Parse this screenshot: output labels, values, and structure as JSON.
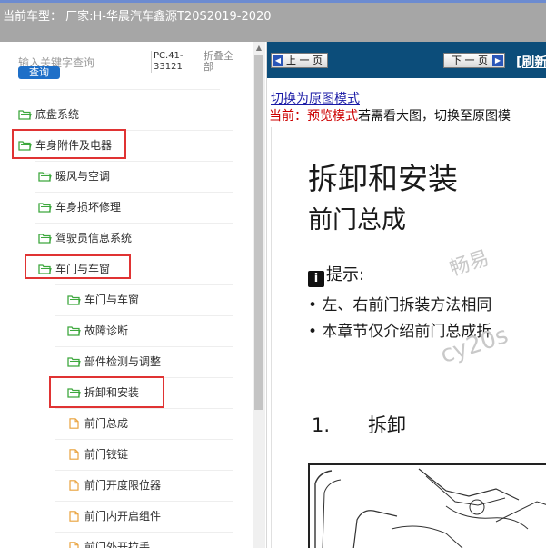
{
  "window": {
    "title": "当前车型： 厂家:H-华晨汽车鑫源T20S2019-2020"
  },
  "left_panel": {
    "search_placeholder": "输入关键字查询",
    "search_button": "查询",
    "pc_code": "PC.41-33121",
    "collapse_all": "折叠全部",
    "tree": [
      {
        "label": "底盘系统",
        "icon": "folder-open-icon"
      },
      {
        "label": "车身附件及电器",
        "icon": "folder-open-icon"
      },
      {
        "label": "暖风与空调",
        "icon": "folder-open-icon"
      },
      {
        "label": "车身损坏修理",
        "icon": "folder-open-icon"
      },
      {
        "label": "驾驶员信息系统",
        "icon": "folder-open-icon"
      },
      {
        "label": "车门与车窗",
        "icon": "folder-open-icon"
      },
      {
        "label": "车门与车窗",
        "icon": "folder-open-icon"
      },
      {
        "label": "故障诊断",
        "icon": "folder-open-icon"
      },
      {
        "label": "部件检测与调整",
        "icon": "folder-open-icon"
      },
      {
        "label": "拆卸和安装",
        "icon": "folder-open-icon"
      },
      {
        "label": "前门总成",
        "icon": "document-icon"
      },
      {
        "label": "前门铰链",
        "icon": "document-icon"
      },
      {
        "label": "前门开度限位器",
        "icon": "document-icon"
      },
      {
        "label": "前门内开启组件",
        "icon": "document-icon"
      },
      {
        "label": "前门外开拉手",
        "icon": "document-icon"
      }
    ]
  },
  "right_panel": {
    "prev_button": "上 一 页",
    "next_button": "下 一 页",
    "refresh": "[刷新",
    "switch_link": "切换为原图模式",
    "current_label": "当前：",
    "current_mode": "预览模式",
    "current_hint": "若需看大图，切换至原图模",
    "doc": {
      "title": "拆卸和安装",
      "subtitle": "前门总成",
      "tip_label": "提示:",
      "bullets": [
        "• 左、右前门拆装方法相同",
        "• 本章节仅介绍前门总成拆"
      ],
      "step_number": "1.",
      "step_text": "拆卸",
      "watermark_1": "畅易",
      "watermark_2": "cy20s"
    }
  },
  "colors": {
    "nav_bar": "#0c4d7a",
    "highlight_box": "#e03333",
    "folder_icon": "#3ea83e",
    "doc_icon": "#e9a23c"
  }
}
